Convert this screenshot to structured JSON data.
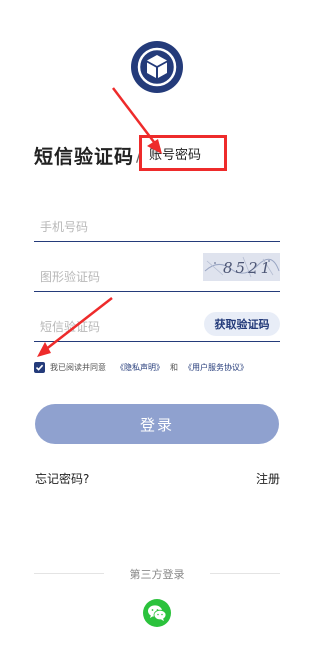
{
  "tabs": {
    "sms_login": "短信验证码",
    "separator": "/",
    "account_login": "账号密码"
  },
  "form": {
    "phone_placeholder": "手机号码",
    "image_code_placeholder": "图形验证码",
    "sms_code_placeholder": "短信验证码",
    "get_code_label": "获取验证码",
    "captcha_text": "8521"
  },
  "agreement": {
    "checked": true,
    "prefix": "我已阅读并同意",
    "privacy_link": "《隐私声明》",
    "and": "和",
    "user_agreement_link": "《用户服务协议》"
  },
  "login_button_label": "登录",
  "forgot_password": "忘记密码?",
  "register": "注册",
  "third_party": {
    "label": "第三方登录",
    "providers": [
      "wechat-icon"
    ]
  },
  "colors": {
    "brand": "#243b7a",
    "login_button": "#8fa1cf",
    "annotation": "#ee2b2b",
    "wechat": "#2bc23c"
  }
}
